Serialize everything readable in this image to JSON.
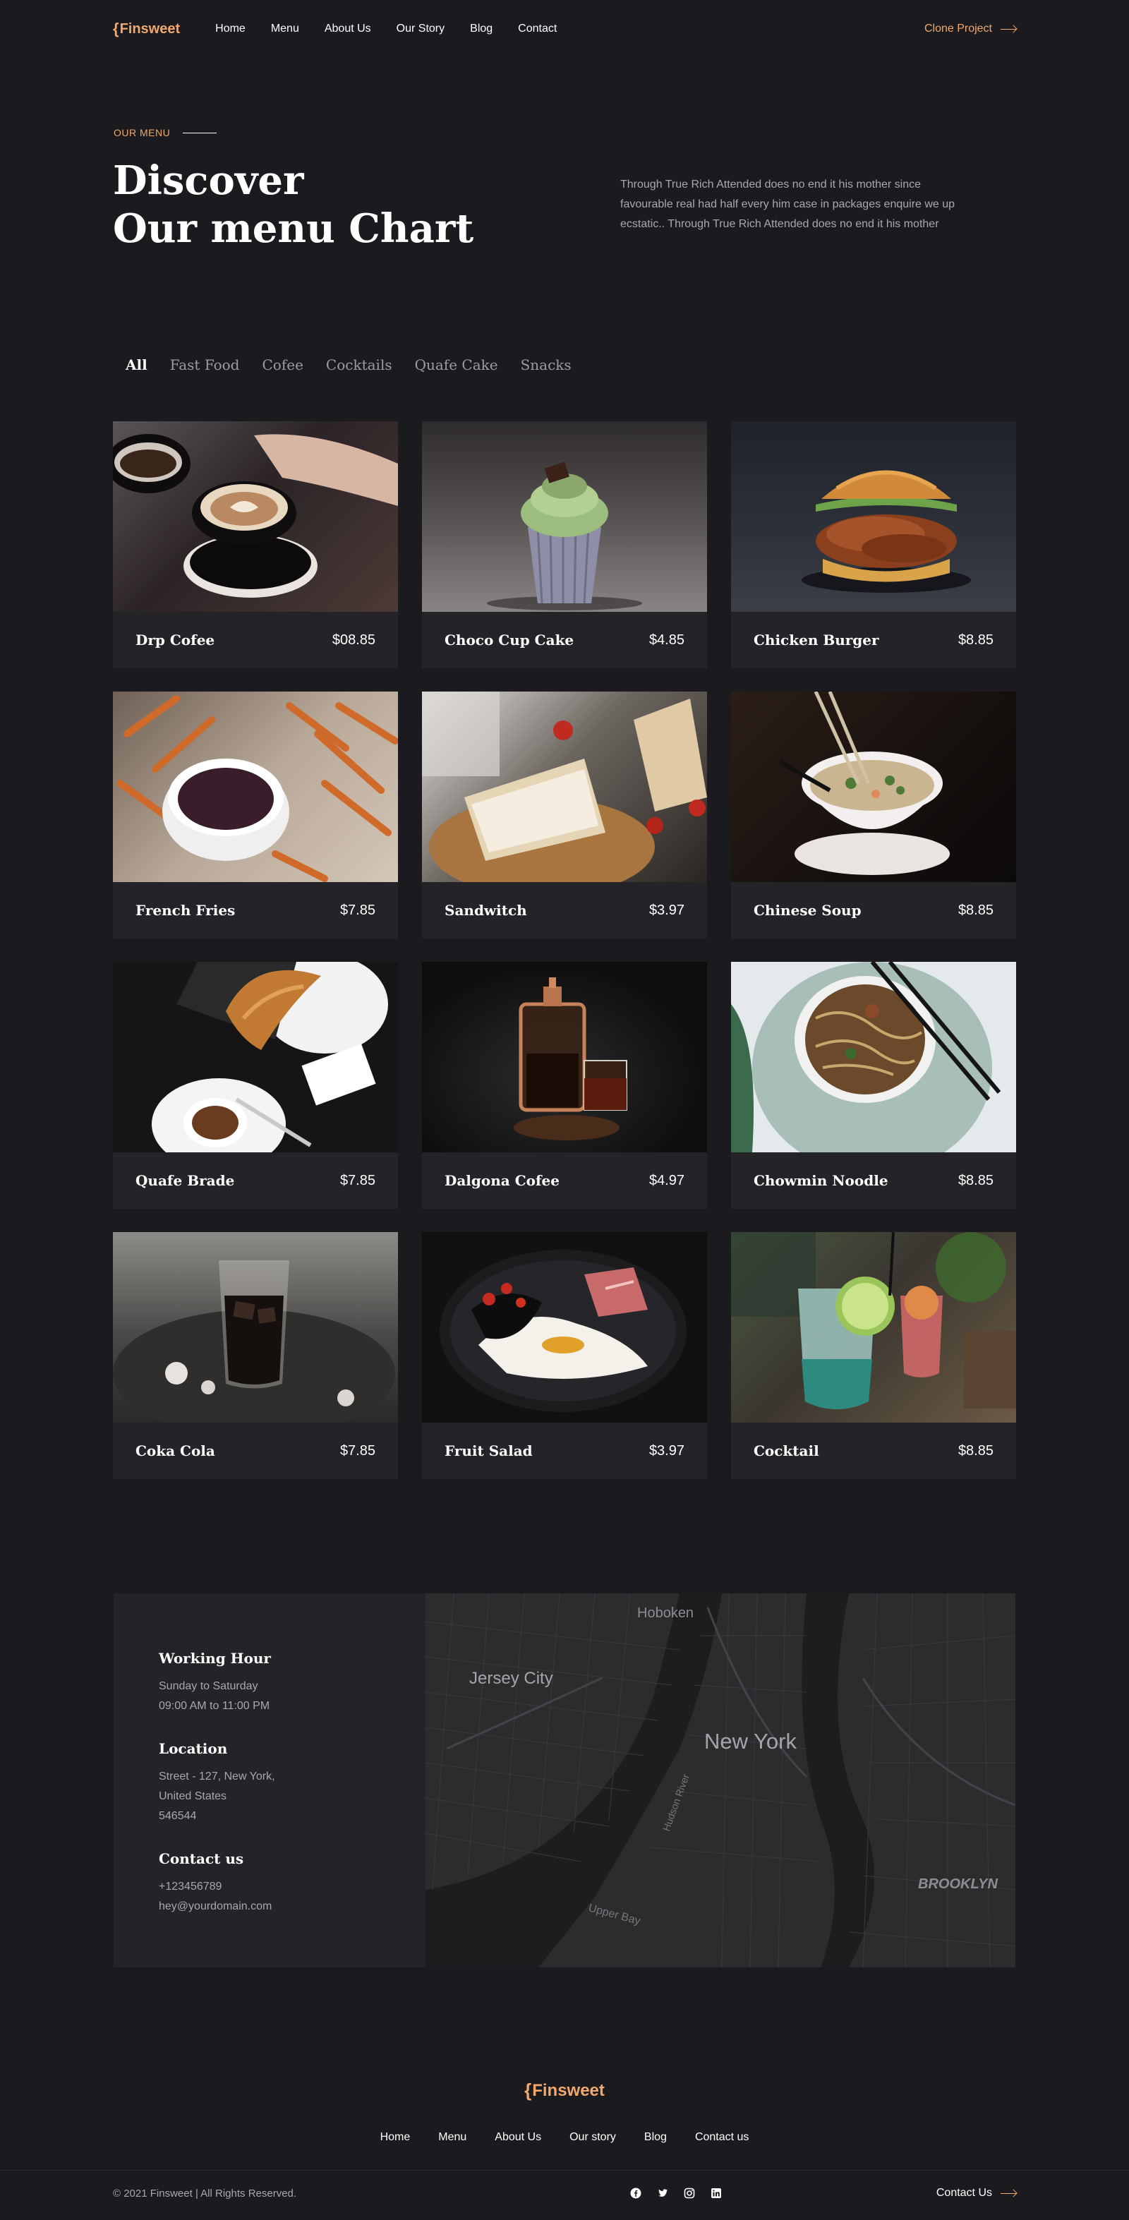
{
  "nav": {
    "logo": "Finsweet",
    "links": [
      "Home",
      "Menu",
      "About Us",
      "Our Story",
      "Blog",
      "Contact"
    ],
    "cta": "Clone Project"
  },
  "hero": {
    "eyebrow": "OUR MENU",
    "title_line1": "Discover",
    "title_line2": "Our menu Chart",
    "description": "Through True Rich Attended does no end it his mother since favourable real had half every him case in packages enquire we up ecstatic.. Through True Rich Attended does no end it his mother"
  },
  "tabs": [
    "All",
    "Fast Food",
    "Cofee",
    "Cocktails",
    "Quafe Cake",
    "Snacks"
  ],
  "menu": [
    {
      "name": "Drp Cofee",
      "price": "$08.85"
    },
    {
      "name": "Choco Cup Cake",
      "price": "$4.85"
    },
    {
      "name": "Chicken Burger",
      "price": "$8.85"
    },
    {
      "name": "French Fries",
      "price": "$7.85"
    },
    {
      "name": "Sandwitch",
      "price": "$3.97"
    },
    {
      "name": "Chinese Soup",
      "price": "$8.85"
    },
    {
      "name": "Quafe Brade",
      "price": "$7.85"
    },
    {
      "name": "Dalgona Cofee",
      "price": "$4.97"
    },
    {
      "name": "Chowmin Noodle",
      "price": "$8.85"
    },
    {
      "name": "Coka Cola",
      "price": "$7.85"
    },
    {
      "name": "Fruit Salad",
      "price": "$3.97"
    },
    {
      "name": "Cocktail",
      "price": "$8.85"
    }
  ],
  "contact": {
    "hours_title": "Working Hour",
    "hours_days": "Sunday to Saturday",
    "hours_time": "09:00 AM to 11:00 PM",
    "location_title": "Location",
    "location_line1": "Street - 127, New York,",
    "location_line2": "United States",
    "location_line3": "546544",
    "contact_title": "Contact us",
    "phone": "+123456789",
    "email": "hey@yourdomain.com"
  },
  "map": {
    "labels": {
      "hoboken": "Hoboken",
      "jersey": "Jersey City",
      "newyork": "New York",
      "brooklyn": "BROOKLYN",
      "upperbay": "Upper Bay",
      "hudson": "Hudson River"
    }
  },
  "footer": {
    "logo": "Finsweet",
    "links": [
      "Home",
      "Menu",
      "About Us",
      "Our story",
      "Blog",
      "Contact us"
    ],
    "copyright": "© 2021 Finsweet | All Rights Reserved.",
    "cta": "Contact Us",
    "social_icons": [
      "facebook-icon",
      "twitter-icon",
      "instagram-icon",
      "linkedin-icon"
    ]
  },
  "colors": {
    "background": "#1b1a1f",
    "card": "#242328",
    "accent": "#f0a86b",
    "muted_text": "#a9a8ad"
  }
}
